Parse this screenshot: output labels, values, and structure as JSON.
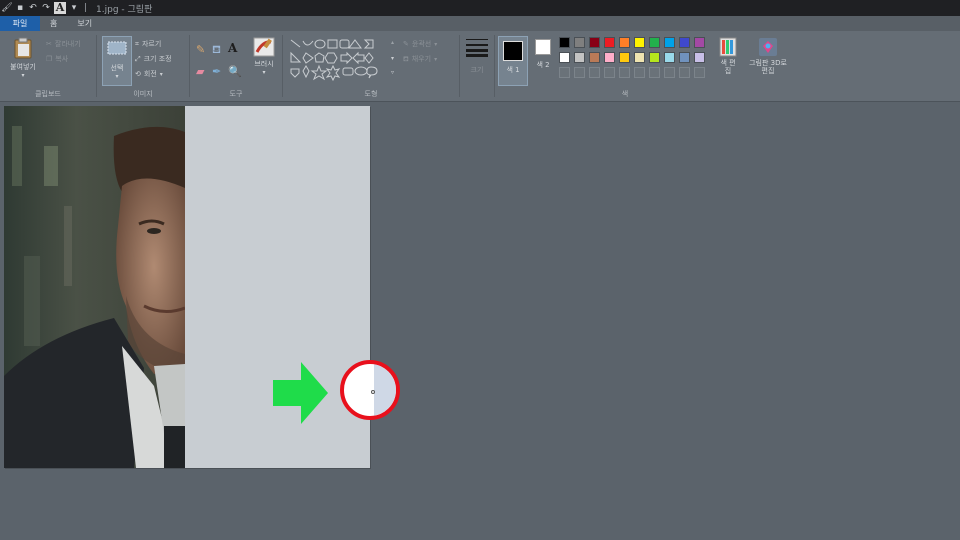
{
  "titlebar": {
    "separator": "|",
    "title": "1.jpg - 그림판",
    "text_icon_label": "A"
  },
  "menu": {
    "tabs": [
      {
        "label": "파일"
      },
      {
        "label": "홈"
      },
      {
        "label": "보기"
      }
    ]
  },
  "ribbon": {
    "clipboard": {
      "paste_label": "붙여넣기",
      "cut_label": "잘라내기",
      "copy_label": "복사",
      "group_label": "클립보드"
    },
    "image": {
      "select_label": "선택",
      "crop_label": "자르기",
      "resize_label": "크기 조정",
      "rotate_label": "회전",
      "group_label": "이미지"
    },
    "tools": {
      "brushes_label": "브러시",
      "group_label": "도구"
    },
    "shapes": {
      "outline_label": "윤곽선",
      "fill_label": "채우기",
      "group_label": "도형"
    },
    "size": {
      "label": "크기"
    },
    "colors": {
      "color1_label": "색 1",
      "color2_label": "색 2",
      "edit_colors_label": "색 편집",
      "paint3d_label": "그림판 3D로 편집",
      "group_label": "색",
      "palette_row1": [
        "#000000",
        "#7f7f7f",
        "#880015",
        "#ed1c24",
        "#ff7f27",
        "#fff200",
        "#22b14c",
        "#00a2e8",
        "#3f48cc",
        "#a349a4"
      ],
      "palette_row2": [
        "#ffffff",
        "#c3c3c3",
        "#b97a57",
        "#ffaec9",
        "#ffc90e",
        "#efe4b0",
        "#b5e61d",
        "#99d9ea",
        "#7092be",
        "#c8bfe7"
      ],
      "color1": "#000000",
      "color2": "#ffffff"
    }
  },
  "annotation": {
    "arrow_color": "#1fdc4a",
    "circle_color": "#e8101c"
  }
}
